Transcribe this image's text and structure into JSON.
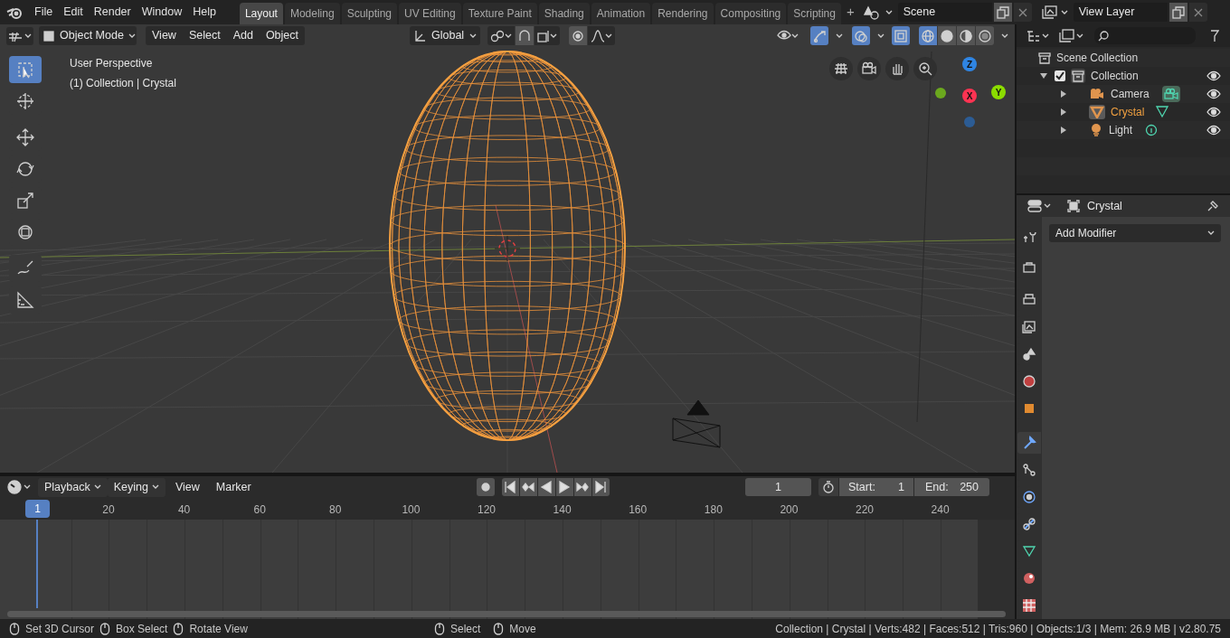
{
  "top_bar": {
    "menus": [
      "File",
      "Edit",
      "Render",
      "Window",
      "Help"
    ],
    "workspaces": [
      {
        "label": "Layout",
        "selected": true
      },
      {
        "label": "Modeling",
        "selected": false
      },
      {
        "label": "Sculpting",
        "selected": false
      },
      {
        "label": "UV Editing",
        "selected": false
      },
      {
        "label": "Texture Paint",
        "selected": false
      },
      {
        "label": "Shading",
        "selected": false
      },
      {
        "label": "Animation",
        "selected": false
      },
      {
        "label": "Rendering",
        "selected": false
      },
      {
        "label": "Compositing",
        "selected": false
      },
      {
        "label": "Scripting",
        "selected": false
      }
    ],
    "add_workspace": "+",
    "scene": "Scene",
    "view_layer": "View Layer"
  },
  "viewport": {
    "header": {
      "mode": "Object Mode",
      "menus": [
        "View",
        "Select",
        "Add",
        "Object"
      ],
      "orientation": "Global",
      "toggles": [
        {
          "on": true
        },
        {
          "on": true
        },
        {
          "on": true
        }
      ],
      "shading": [
        {
          "selected": true
        },
        {
          "selected": false
        },
        {
          "selected": false
        },
        {
          "selected": false
        }
      ]
    },
    "overlay_text": [
      "User Perspective",
      "(1) Collection | Crystal"
    ],
    "tools": [
      {
        "selected": true
      },
      {
        "selected": false
      },
      {
        "selected": false
      },
      {
        "selected": false
      },
      {
        "selected": false
      },
      {
        "selected": false
      },
      {
        "selected": false
      },
      {
        "selected": false
      }
    ],
    "axes": [
      {
        "label": "Z",
        "color": "#2f85e3"
      },
      {
        "label": "Y",
        "color": "#8bdc00"
      },
      {
        "label": "X",
        "color": "#ff3352"
      }
    ]
  },
  "outliner": {
    "root": "Scene Collection",
    "items": [
      {
        "label": "Collection",
        "kind": "collection",
        "expanded": true,
        "checked": true,
        "selected": false,
        "visible": true,
        "children": [
          {
            "label": "Camera",
            "kind": "camera",
            "expanded": false,
            "selected": false,
            "visible": true
          },
          {
            "label": "Crystal",
            "kind": "mesh",
            "expanded": false,
            "selected": true,
            "visible": true
          },
          {
            "label": "Light",
            "kind": "light",
            "expanded": false,
            "selected": false,
            "visible": true
          }
        ]
      }
    ]
  },
  "properties": {
    "title": "Crystal",
    "add_modifier": "Add Modifier",
    "tabs": [
      {
        "selected": false
      },
      {
        "selected": false
      },
      {
        "selected": false
      },
      {
        "selected": false
      },
      {
        "selected": false
      },
      {
        "selected": false
      },
      {
        "selected": false
      },
      {
        "selected": true
      },
      {
        "selected": false
      },
      {
        "selected": false
      },
      {
        "selected": false
      },
      {
        "selected": false
      },
      {
        "selected": false
      },
      {
        "selected": false
      }
    ]
  },
  "timeline": {
    "dropdowns": [
      "Playback",
      "Keying"
    ],
    "menus": [
      "View",
      "Marker"
    ],
    "current_frame": "1",
    "start_label": "Start:",
    "start": "1",
    "end_label": "End:",
    "end": "250",
    "playhead": "1",
    "ruler": [
      "20",
      "40",
      "60",
      "80",
      "100",
      "120",
      "140",
      "160",
      "180",
      "200",
      "220",
      "240"
    ]
  },
  "status_bar": {
    "hints_left": [
      "Set 3D Cursor",
      "Box Select",
      "Rotate View"
    ],
    "hints_center": [
      "Select",
      "Move"
    ],
    "stats": "Collection | Crystal | Verts:482 | Faces:512 | Tris:960 | Objects:1/3 | Mem: 26.9 MB | v2.80.75"
  }
}
